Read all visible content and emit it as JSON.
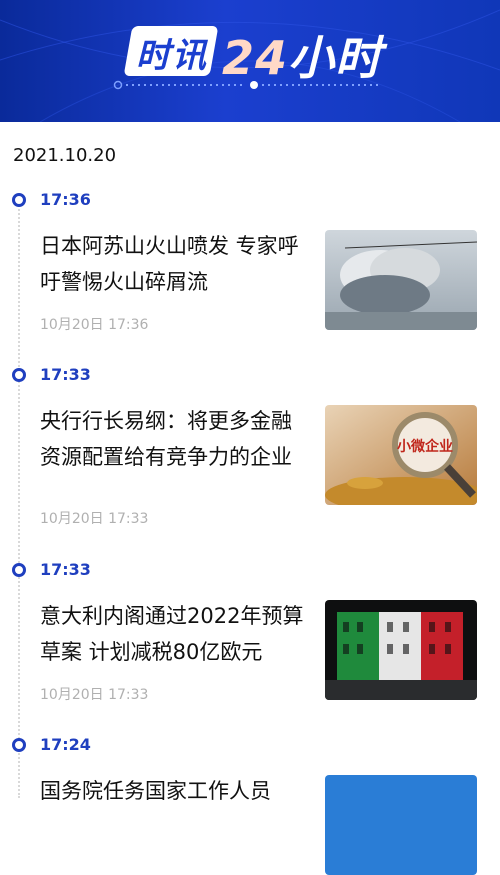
{
  "header": {
    "title_part1": "时讯",
    "title_num": "24",
    "title_part2": "小时"
  },
  "date": "2021.10.20",
  "entries": [
    {
      "time": "17:36",
      "headline": "日本阿苏山火山喷发 专家呼吁警惕火山碎屑流",
      "meta": "10月20日 17:36",
      "image": "volcano-eruption-image"
    },
    {
      "time": "17:33",
      "headline": "央行行长易纲：将更多金融资源配置给有竞争力的企业",
      "meta": "10月20日 17:33",
      "image": "magnifier-coins-image",
      "image_text": "小微企业"
    },
    {
      "time": "17:33",
      "headline": "意大利内阁通过2022年预算草案 计划减税80亿欧元",
      "meta": "10月20日 17:33",
      "image": "italy-flag-building-image"
    },
    {
      "time": "17:24",
      "headline": "国务院任务国家工作人员",
      "meta": "",
      "image": "partial-blue-image"
    }
  ],
  "colors": {
    "accent": "#1f3fbf",
    "banner": "#1b3fcf",
    "meta": "#b0b0b0"
  }
}
